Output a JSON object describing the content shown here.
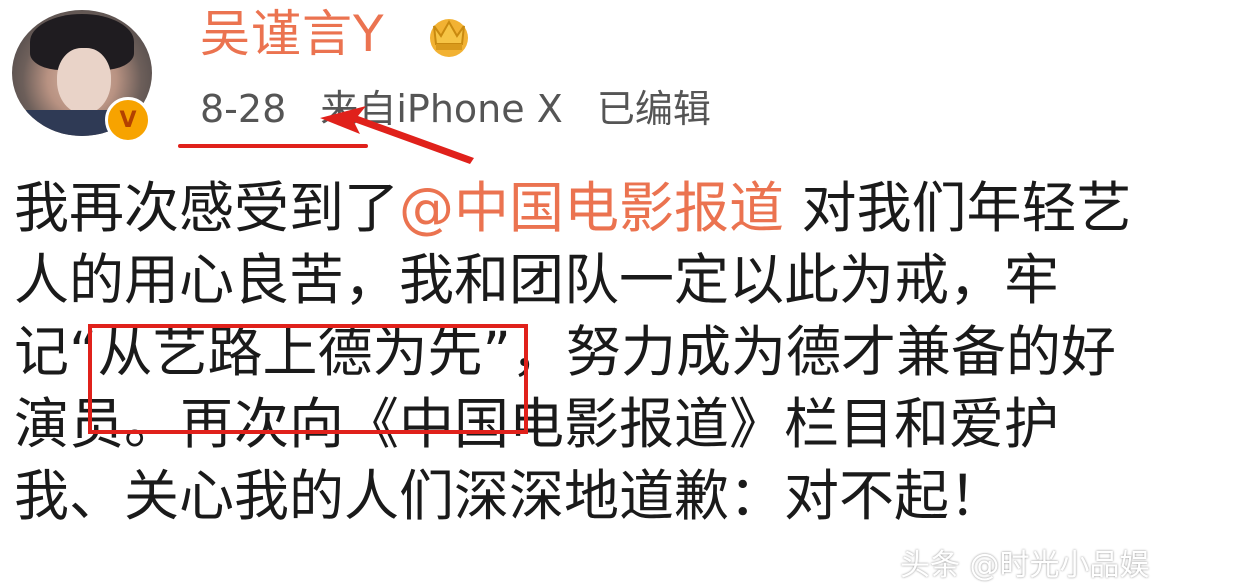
{
  "post": {
    "username": "吴谨言Y",
    "date": "8-28",
    "source": "来自iPhone X",
    "edited": "已编辑",
    "content": {
      "line1_a": "我再次感受到了",
      "line1_mention": "@中国电影报道",
      "line1_b": " 对我们年轻艺",
      "line2": "人的用心良苦，我和团队一定以此为戒，牢",
      "line3": "记“从艺路上德为先”，努力成为德才兼备的好",
      "line4": "演员。再次向《中国电影报道》栏目和爱护",
      "line5": "我、关心我的人们深深地道歉：对不起！"
    }
  },
  "icons": {
    "verified": "verified-v-badge",
    "crown": "crown-icon"
  },
  "colors": {
    "username": "#eb7350",
    "mention": "#eb7350",
    "annotation": "#e0211b",
    "verified": "#f7a300"
  },
  "watermark": "头条 @时光小品娱"
}
